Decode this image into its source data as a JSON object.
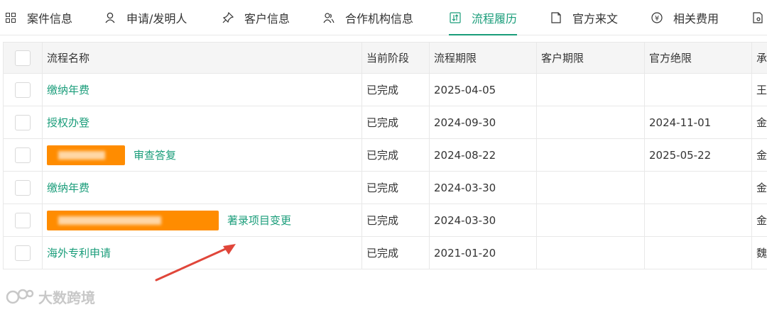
{
  "tabs": [
    {
      "label": "案件信息",
      "icon": "grid-icon"
    },
    {
      "label": "申请/发明人",
      "icon": "person-icon"
    },
    {
      "label": "客户信息",
      "icon": "pin-icon"
    },
    {
      "label": "合作机构信息",
      "icon": "people-icon"
    },
    {
      "label": "流程履历",
      "icon": "flow-icon",
      "active": true
    },
    {
      "label": "官方来文",
      "icon": "document-icon"
    },
    {
      "label": "相关费用",
      "icon": "yen-icon"
    }
  ],
  "table": {
    "headers": [
      "流程名称",
      "当前阶段",
      "流程期限",
      "客户期限",
      "官方绝限",
      "承"
    ],
    "rows": [
      {
        "name": "缴纳年费",
        "stage": "已完成",
        "deadline": "2025-04-05",
        "client": "",
        "official": "",
        "owner": "王"
      },
      {
        "name": "授权办登",
        "stage": "已完成",
        "deadline": "2024-09-30",
        "client": "",
        "official": "2024-11-01",
        "owner": "金"
      },
      {
        "name": "审查答复",
        "stage": "已完成",
        "deadline": "2024-08-22",
        "client": "",
        "official": "2025-05-22",
        "owner": "金",
        "redacted": true
      },
      {
        "name": "缴纳年费",
        "stage": "已完成",
        "deadline": "2024-03-30",
        "client": "",
        "official": "",
        "owner": "金"
      },
      {
        "name": "著录项目变更",
        "stage": "已完成",
        "deadline": "2024-03-30",
        "client": "",
        "official": "",
        "owner": "金",
        "redacted": true
      },
      {
        "name": "海外专利申请",
        "stage": "已完成",
        "deadline": "2021-01-20",
        "client": "",
        "official": "",
        "owner": "魏"
      }
    ]
  },
  "watermark": {
    "text": "大数跨境"
  },
  "colors": {
    "accent": "#1a9d7a",
    "annotation_arrow": "#e0463a",
    "redaction": "#ff8c00"
  }
}
